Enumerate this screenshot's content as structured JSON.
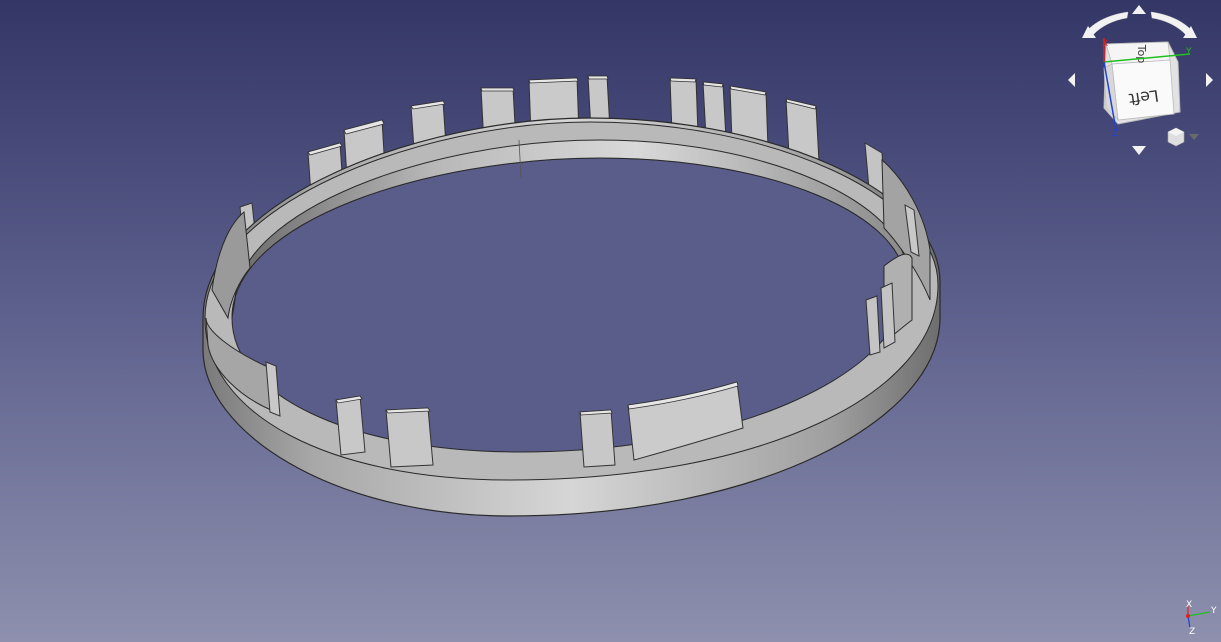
{
  "viewport": {
    "name": "3D view",
    "background_top": "#343766",
    "background_bottom": "#8e90ae",
    "model_color": "#c8c8c8"
  },
  "navigation_cube": {
    "face_left_label": "Left",
    "face_top_label": "Top",
    "axis_x_label": "X",
    "axis_y_label": "Y",
    "axis_z_label": "Z",
    "axis_x_color": "#e02020",
    "axis_y_color": "#20c020",
    "axis_z_color": "#2040e0",
    "arrows": [
      "rotate-left-arrow",
      "rotate-right-arrow",
      "up-arrow",
      "down-arrow",
      "left-arrow",
      "right-arrow"
    ],
    "menu_icon": "view-menu-cube-icon"
  },
  "axis_triad": {
    "x_label": "X",
    "y_label": "Y",
    "z_label": "Z"
  }
}
